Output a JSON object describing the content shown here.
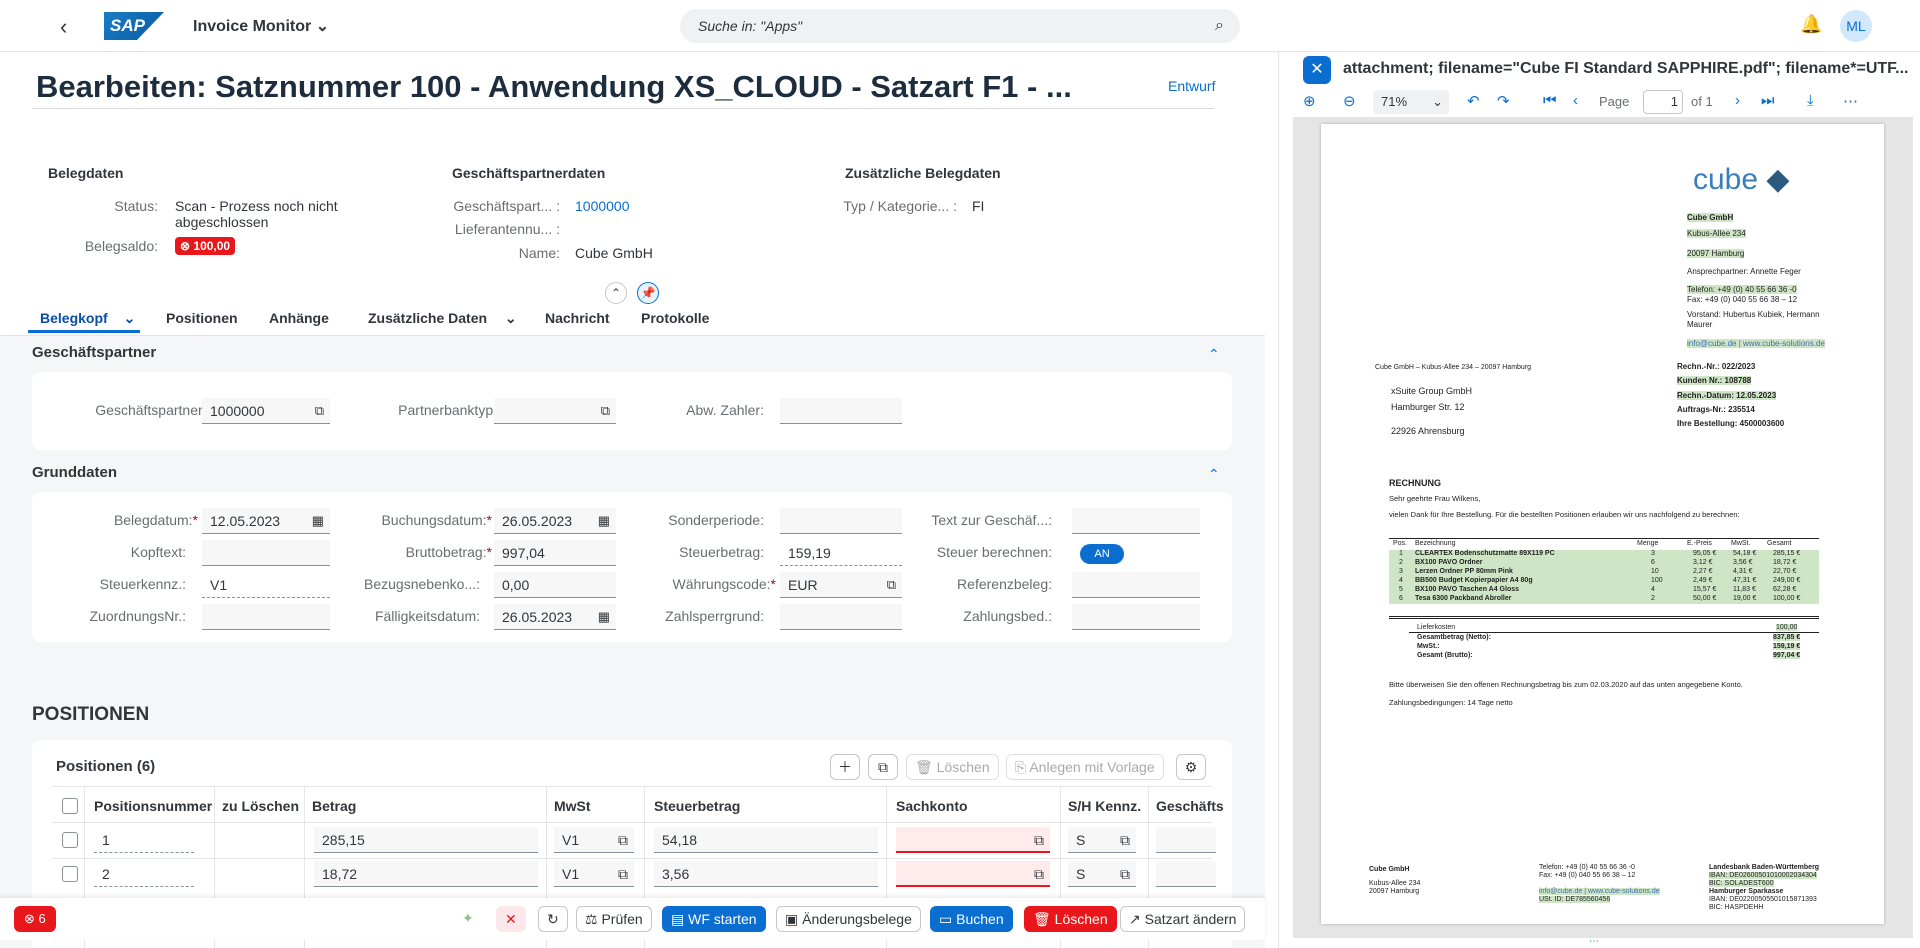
{
  "shell": {
    "app_title": "Invoice Monitor",
    "logo": "SAP",
    "search_placeholder": "Suche in: \"Apps\"",
    "avatar": "ML"
  },
  "header": {
    "title": "Bearbeiten: Satznummer 100 - Anwendung XS_CLOUD - Satzart F1 - ...",
    "status": "Entwurf"
  },
  "belegdaten": {
    "title": "Belegdaten",
    "status_label": "Status:",
    "status_value_1": "Scan - Prozess noch nicht",
    "status_value_2": "abgeschlossen",
    "saldo_label": "Belegsaldo:",
    "saldo_value": "100,00"
  },
  "partner": {
    "title": "Geschäftspartnerdaten",
    "gp_label": "Geschäftspart... :",
    "gp_value": "1000000",
    "lief_label": "Lieferantennu... :",
    "name_label": "Name:",
    "name_value": "Cube GmbH"
  },
  "zusatz": {
    "title": "Zusätzliche Belegdaten",
    "typ_label": "Typ / Kategorie... :",
    "typ_value": "FI"
  },
  "tabs": [
    {
      "label": "Belegkopf"
    },
    {
      "label": "Positionen"
    },
    {
      "label": "Anhänge"
    },
    {
      "label": "Zusätzliche Daten"
    },
    {
      "label": "Nachricht"
    },
    {
      "label": "Protokolle"
    }
  ],
  "gp_section": {
    "title": "Geschäftspartner",
    "gp_label": "Geschäftspartner:",
    "gp_value": "1000000",
    "bank_label": "Partnerbanktyp:",
    "abw_label": "Abw. Zahler:"
  },
  "grund": {
    "title": "Grunddaten",
    "belegdatum_label": "Belegdatum:",
    "belegdatum": "12.05.2023",
    "kopftext_label": "Kopftext:",
    "steuerkennz_label": "Steuerkennz.:",
    "steuerkennz": "V1",
    "zuordnung_label": "ZuordnungsNr.:",
    "buchungsdatum_label": "Buchungsdatum:",
    "buchungsdatum": "26.05.2023",
    "brutto_label": "Bruttobetrag:",
    "brutto": "997,04",
    "bezugs_label": "Bezugsnebenko...:",
    "bezugs": "0,00",
    "faellig_label": "Fälligkeitsdatum:",
    "faellig": "26.05.2023",
    "sonder_label": "Sonderperiode:",
    "steuerbetrag_label": "Steuerbetrag:",
    "steuerbetrag": "159,19",
    "waehrung_label": "Währungscode:",
    "waehrung": "EUR",
    "zahlsperr_label": "Zahlsperrgrund:",
    "text_label": "Text zur Geschäf...:",
    "steuerber_label": "Steuer berechnen:",
    "steuerber": "AN",
    "referenz_label": "Referenzbeleg:",
    "zahlungsbed_label": "Zahlungsbed.:"
  },
  "positionen": {
    "heading": "POSITIONEN",
    "table_title": "Positionen (6)",
    "btn_loeschen": "Löschen",
    "btn_vorlage": "Anlegen mit Vorlage",
    "columns": [
      "Positionsnummer",
      "zu Löschen",
      "Betrag",
      "MwSt",
      "Steuerbetrag",
      "Sachkonto",
      "S/H Kennz.",
      "Geschäfts"
    ],
    "rows": [
      {
        "pos": "1",
        "betrag": "285,15",
        "mwst": "V1",
        "steuer": "54,18",
        "sh": "S"
      },
      {
        "pos": "2",
        "betrag": "18,72",
        "mwst": "V1",
        "steuer": "3,56",
        "sh": "S"
      }
    ]
  },
  "footer": {
    "errors": "6",
    "pruefen": "Prüfen",
    "wf": "WF starten",
    "aenderung": "Änderungsbelege",
    "buchen": "Buchen",
    "loeschen": "Löschen",
    "satzart": "Satzart ändern"
  },
  "pdf": {
    "title": "attachment; filename=\"Cube FI Standard SAPPHIRE.pdf\"; filename*=UTF...",
    "zoom": "71%",
    "page_label": "Page",
    "page": "1",
    "of": "of 1"
  },
  "doc": {
    "brand": "cube",
    "company": "Cube GmbH",
    "street": "Kubus-Allee 234",
    "city": "20097 Hamburg",
    "contact": "Ansprechpartner: Annette Feger",
    "tel": "Telefon: +49 (0) 40 55 66 36 -0",
    "fax": "Fax: +49 (0) 040 55 66 38 – 12",
    "vorstand1": "Vorstand: Hubertus Kubiek, Hermann",
    "vorstand2": "Maurer",
    "web": "info@cube.de | www.cube-solutions.de",
    "sender": "Cube GmbH – Kubus-Allee 234 – 20097 Hamburg",
    "to1": "xSuite Group GmbH",
    "to2": "Hamburger Str. 12",
    "to3": "22926 Ahrensburg",
    "rechnr": "Rechn.-Nr.: 022/2023",
    "kundnr": "Kunden Nr.: 108788",
    "rechdat": "Rechn.-Datum: 12.05.2023",
    "auftrag": "Auftrags-Nr.: 235514",
    "bestellung": "Ihre Bestellung: 4500003600",
    "rechnung": "RECHNUNG",
    "anrede": "Sehr geehrte Frau Wilkens,",
    "dank": "vielen Dank für Ihre Bestellung. Für die bestellten Positionen erlauben wir uns nachfolgend zu berechnen:",
    "thead": [
      "Pos.",
      "Bezeichnung",
      "Menge",
      "E.-Preis",
      "MwSt.",
      "Gesamt"
    ],
    "items": [
      {
        "p": "1",
        "d": "CLEARTEX Bodenschutzmatte 89X119 PC",
        "m": "3",
        "e": "95,05 €",
        "w": "54,18 €",
        "g": "285,15 €"
      },
      {
        "p": "2",
        "d": "BX100 PAVO Ordner",
        "m": "6",
        "e": "3,12 €",
        "w": "3,56 €",
        "g": "18,72 €"
      },
      {
        "p": "3",
        "d": "Lerzen Ordner PP 80mm Pink",
        "m": "10",
        "e": "2,27 €",
        "w": "4,31 €",
        "g": "22,70 €"
      },
      {
        "p": "4",
        "d": "BB500 Budget Kopierpapier A4 80g",
        "m": "100",
        "e": "2,49 €",
        "w": "47,31 €",
        "g": "249,00 €"
      },
      {
        "p": "5",
        "d": "BX100 PAVO Taschen A4 Gloss",
        "m": "4",
        "e": "15,57 €",
        "w": "11,83 €",
        "g": "62,28 €"
      },
      {
        "p": "6",
        "d": "Tesa 6300 Packband Abroller",
        "m": "2",
        "e": "50,00 €",
        "w": "19,00 €",
        "g": "100,00 €"
      }
    ],
    "liefer": "Lieferkosten",
    "liefer_v": "100,00",
    "netto": "Gesamtbetrag (Netto):",
    "netto_v": "837,85 €",
    "mwst": "MwSt.:",
    "mwst_v": "159,19 €",
    "brutto": "Gesamt (Brutto):",
    "brutto_v": "997,04 €",
    "bitte": "Bitte überweisen Sie den offenen Rechnungsbetrag bis zum 02.03.2020 auf das unten angegebene Konto.",
    "zahl": "Zahlungsbedingungen: 14 Tage netto",
    "f_c": "Cube GmbH",
    "f_s": "Kubus-Allee 234",
    "f_z": "20097 Hamburg",
    "f_tel": "Telefon: +49 (0) 40 55 66 36 -0",
    "f_fax": "Fax: +49 (0) 040 55 66 38 – 12",
    "f_web": "info@cube.de | www.cube-solutions.de",
    "f_ust": "USt. ID: DE785560456",
    "f_b1": "Landesbank Baden-Württemberg",
    "f_i1": "IBAN: DE02600501010002034304",
    "f_bic1": "BIC: SOLADEST600",
    "f_b2": "Hamburger Sparkasse",
    "f_i2": "IBAN: DE02200505501015871393",
    "f_bic2": "BIC: HASPDEHH"
  }
}
